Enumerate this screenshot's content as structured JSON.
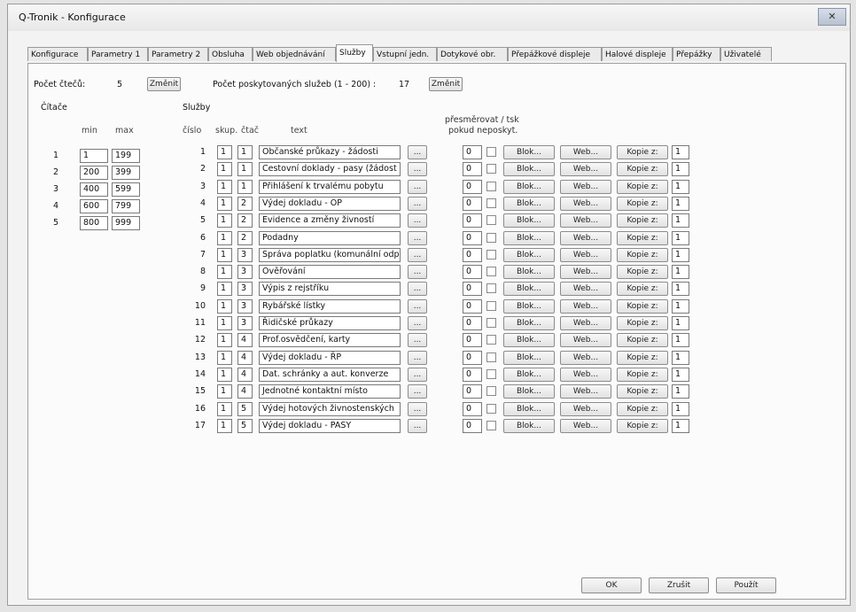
{
  "window": {
    "title": "Q-Tronik - Konfigurace",
    "close_label": "✕"
  },
  "tabs": [
    "Konfigurace",
    "Parametry 1",
    "Parametry 2",
    "Obsluha",
    "Web objednávání",
    "Služby",
    "Vstupní jedn.",
    "Dotykové obr.",
    "Přepážkové displeje",
    "Halové displeje",
    "Přepážky",
    "Uživatelé"
  ],
  "active_tab": "Služby",
  "counts": {
    "readers_label": "Počet čtečů:",
    "readers_value": "5",
    "change_label": "Změnit",
    "services_label": "Počet poskytovaných služeb (1 - 200) :",
    "services_value": "17"
  },
  "readers": {
    "section_label": "Čítače",
    "col_min": "min",
    "col_max": "max",
    "rows": [
      {
        "num": "1",
        "min": "1",
        "max": "199"
      },
      {
        "num": "2",
        "min": "200",
        "max": "399"
      },
      {
        "num": "3",
        "min": "400",
        "max": "599"
      },
      {
        "num": "4",
        "min": "600",
        "max": "799"
      },
      {
        "num": "5",
        "min": "800",
        "max": "999"
      }
    ]
  },
  "services": {
    "section_label": "Služby",
    "col_num": "číslo",
    "col_group": "skup.",
    "col_reader": "čtač",
    "col_text": "text",
    "redirect_header_1": "přesměrovat / tsk",
    "redirect_header_2": "pokud neposkyt.",
    "dots_label": "...",
    "block_label": "Blok...",
    "web_label": "Web...",
    "copy_label": "Kopie z:",
    "rows": [
      {
        "num": "1",
        "group": "1",
        "reader": "1",
        "text": "Občanské průkazy - žádosti",
        "redirect": "0",
        "copy": "1"
      },
      {
        "num": "2",
        "group": "1",
        "reader": "1",
        "text": "Cestovní doklady - pasy (žádost",
        "redirect": "0",
        "copy": "1"
      },
      {
        "num": "3",
        "group": "1",
        "reader": "1",
        "text": "Přihlášení k trvalému pobytu",
        "redirect": "0",
        "copy": "1"
      },
      {
        "num": "4",
        "group": "1",
        "reader": "2",
        "text": "Výdej dokladu - OP",
        "redirect": "0",
        "copy": "1"
      },
      {
        "num": "5",
        "group": "1",
        "reader": "2",
        "text": "Evidence a změny živností",
        "redirect": "0",
        "copy": "1"
      },
      {
        "num": "6",
        "group": "1",
        "reader": "2",
        "text": "Podadny",
        "redirect": "0",
        "copy": "1"
      },
      {
        "num": "7",
        "group": "1",
        "reader": "3",
        "text": "Správa poplatku (komunální odp",
        "redirect": "0",
        "copy": "1"
      },
      {
        "num": "8",
        "group": "1",
        "reader": "3",
        "text": "Ověřování",
        "redirect": "0",
        "copy": "1"
      },
      {
        "num": "9",
        "group": "1",
        "reader": "3",
        "text": "Výpis z rejstříku",
        "redirect": "0",
        "copy": "1"
      },
      {
        "num": "10",
        "group": "1",
        "reader": "3",
        "text": "Rybářské lístky",
        "redirect": "0",
        "copy": "1"
      },
      {
        "num": "11",
        "group": "1",
        "reader": "3",
        "text": "Řidičské průkazy",
        "redirect": "0",
        "copy": "1"
      },
      {
        "num": "12",
        "group": "1",
        "reader": "4",
        "text": "Prof.osvědčení, karty",
        "redirect": "0",
        "copy": "1"
      },
      {
        "num": "13",
        "group": "1",
        "reader": "4",
        "text": "Výdej dokladu - ŘP",
        "redirect": "0",
        "copy": "1"
      },
      {
        "num": "14",
        "group": "1",
        "reader": "4",
        "text": "Dat. schránky a aut. konverze",
        "redirect": "0",
        "copy": "1"
      },
      {
        "num": "15",
        "group": "1",
        "reader": "4",
        "text": "Jednotné kontaktní místo",
        "redirect": "0",
        "copy": "1"
      },
      {
        "num": "16",
        "group": "1",
        "reader": "5",
        "text": "Výdej hotových živnostenských",
        "redirect": "0",
        "copy": "1"
      },
      {
        "num": "17",
        "group": "1",
        "reader": "5",
        "text": "Výdej dokladu - PASY",
        "redirect": "0",
        "copy": "1"
      }
    ]
  },
  "footer": {
    "ok_label": "OK",
    "cancel_label": "Zrušit",
    "apply_label": "Použít"
  }
}
